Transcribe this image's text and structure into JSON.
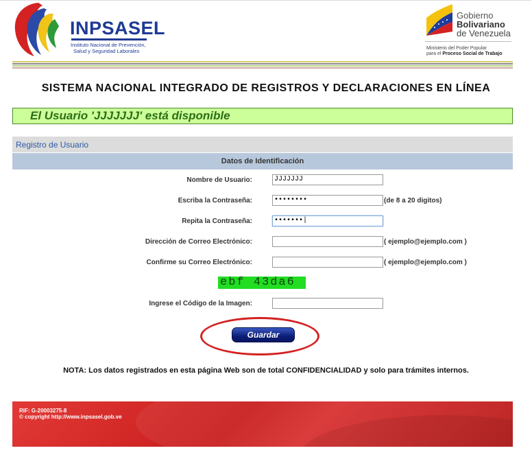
{
  "header": {
    "brand_name": "INPSASEL",
    "brand_subtitle_1": "Instituto Nacional de Prevención,",
    "brand_subtitle_2": "Salud y Seguridad Laborales",
    "gov_line_1": "Gobierno",
    "gov_line_2": "Bolivariano",
    "gov_line_3": "de Venezuela",
    "ministry_line_1": "Ministerio del Poder Popular",
    "ministry_line_2_prefix": "para el ",
    "ministry_line_2_bold": "Proceso Social de Trabajo"
  },
  "title": "SISTEMA NACIONAL INTEGRADO DE REGISTROS Y DECLARACIONES EN LÍNEA",
  "availability_message": "El Usuario 'JJJJJJJ' está disponible",
  "panel": {
    "title": "Registro de Usuario",
    "section_title": "Datos de Identificación"
  },
  "form": {
    "username": {
      "label": "Nombre de Usuario:",
      "value": "JJJJJJJ"
    },
    "password": {
      "label": "Escriba la Contraseña:",
      "value": "••••••••",
      "hint": "(de 8 a 20 digitos)"
    },
    "password_repeat": {
      "label": "Repita la Contraseña:",
      "value": "•••••••|"
    },
    "email": {
      "label": "Dirección de Correo Electrónico:",
      "value": "",
      "hint": "( ejemplo@ejemplo.com )"
    },
    "email_confirm": {
      "label": "Confirme su Correo Electrónico:",
      "value": "",
      "hint": "( ejemplo@ejemplo.com )"
    },
    "captcha_text": "ebf 43da6",
    "captcha_input": {
      "label": "Ingrese el Código de la Imagen:",
      "value": ""
    },
    "save_label": "Guardar"
  },
  "note": "NOTA: Los datos registrados en esta página Web son de total CONFIDENCIALIDAD y solo para trámites internos.",
  "footer": {
    "rif": "RIF: G-20003275-8",
    "copyright": "© copyright http://www.inpsasel.gob.ve"
  },
  "colors": {
    "brand_blue": "#1e3a94",
    "available_bg": "#ccff99",
    "available_text": "#2c6e16",
    "section_bar": "#b8c8dc",
    "footer_red": "#c81e1e",
    "annotation_red": "#d42222"
  }
}
